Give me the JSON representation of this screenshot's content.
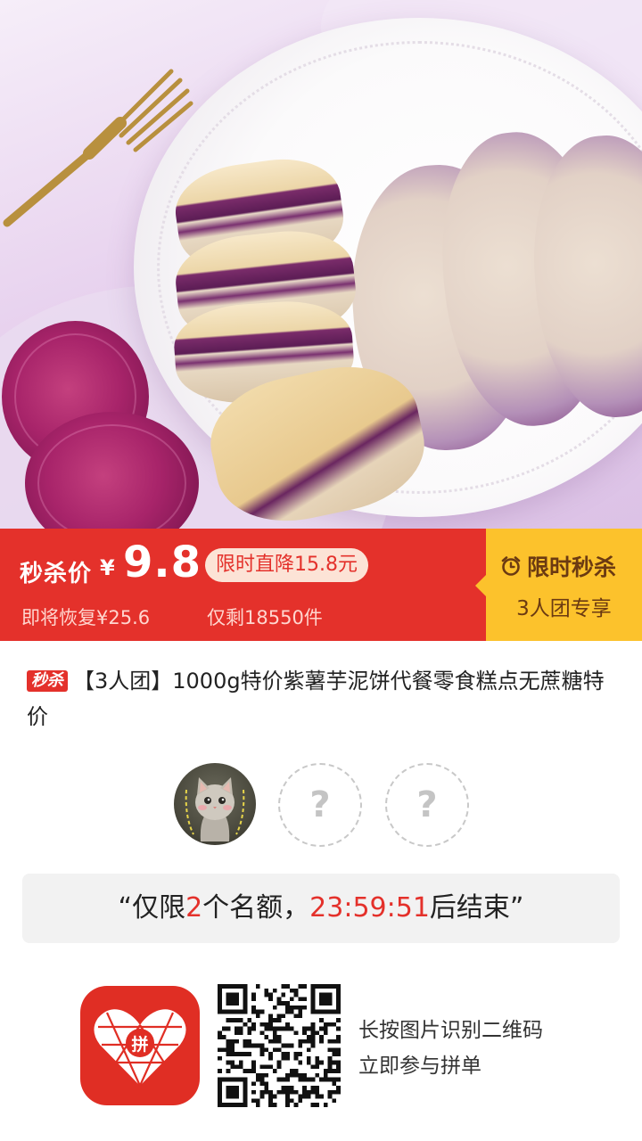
{
  "promo": {
    "price_label": "秒杀价",
    "currency": "¥",
    "price": "9.8",
    "drop_badge": "限时直降15.8元",
    "restore_text": "即将恢复¥25.6",
    "remaining_text": "仅剩18550件",
    "flash_title": "限时秒杀",
    "flash_sub": "3人团专享"
  },
  "product": {
    "badge": "秒杀",
    "title": "【3人团】1000g特价紫薯芋泥饼代餐零食糕点无蔗糖特价"
  },
  "group": {
    "slot_placeholder": "?",
    "quote_prefix": "“仅限",
    "quote_count": "2",
    "quote_mid": "个名额，",
    "quote_time": "23:59:51",
    "quote_suffix": "后结束”"
  },
  "footer": {
    "hint_line1": "长按图片识别二维码",
    "hint_line2": "立即参与拼单",
    "logo_text": "拼"
  },
  "colors": {
    "promo_red": "#e4312b",
    "promo_yellow": "#fcc22c",
    "logo_red": "#e02e24"
  },
  "icons": {
    "clock": "alarm-clock-icon"
  }
}
